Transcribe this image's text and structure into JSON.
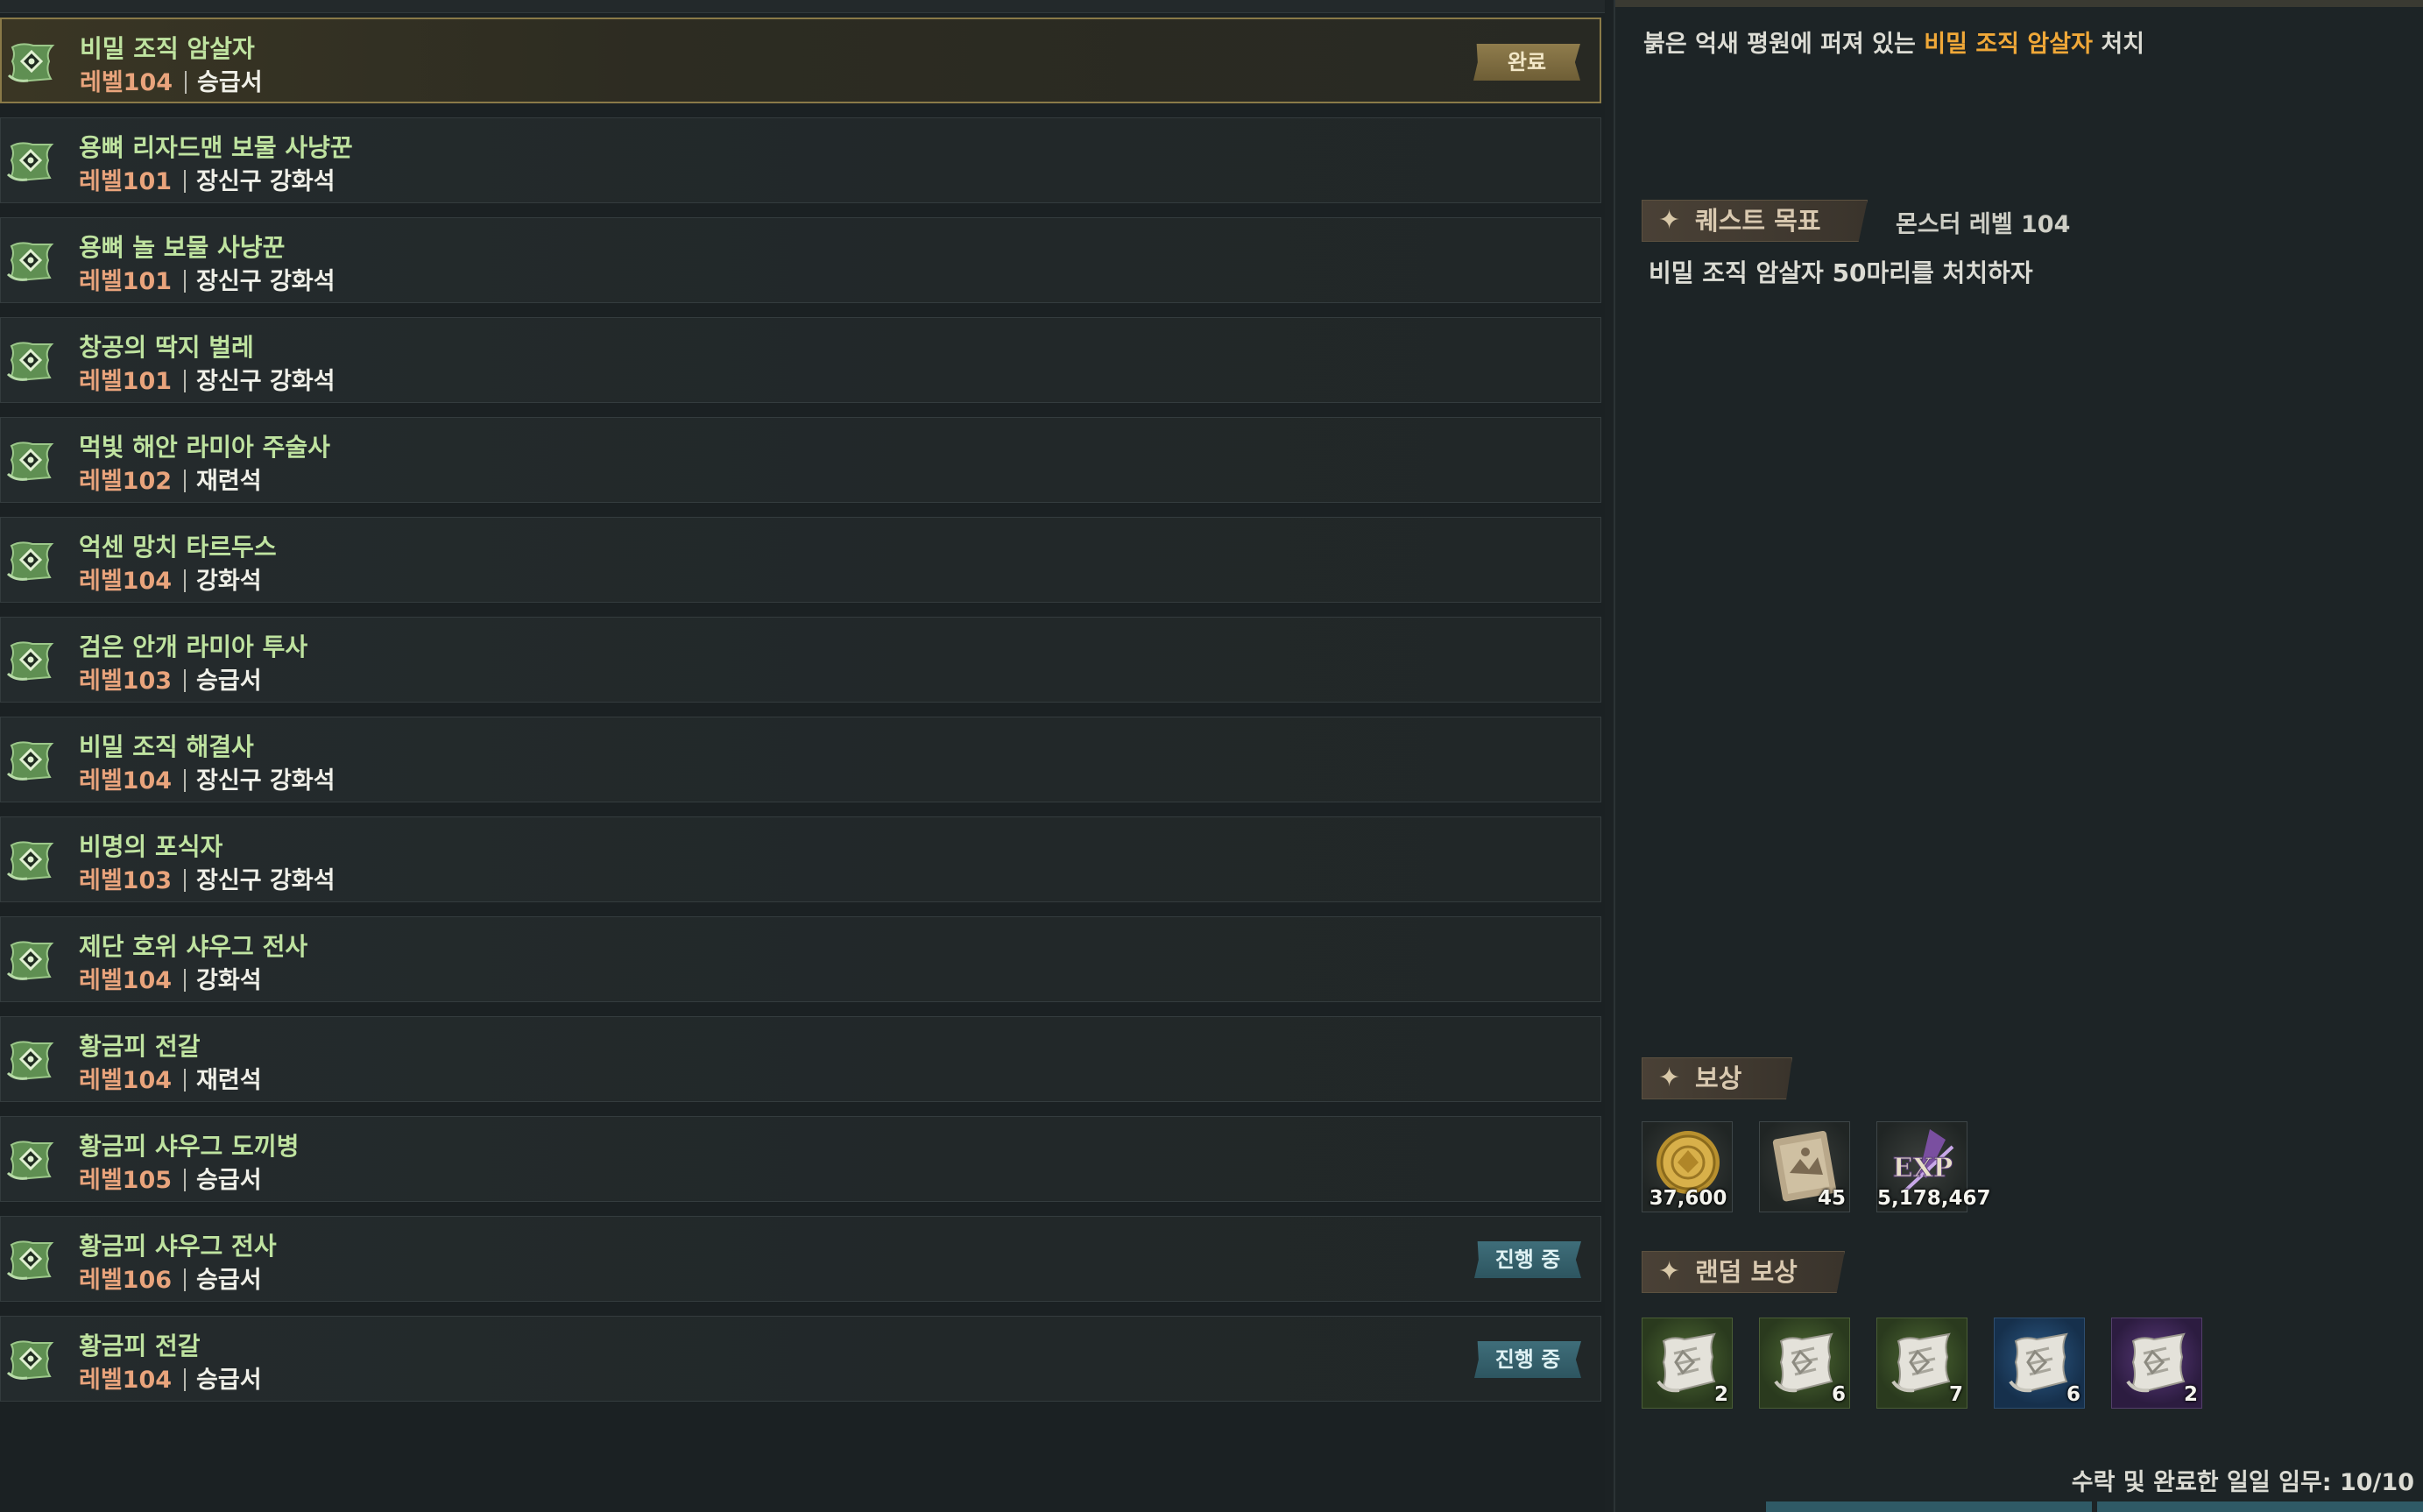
{
  "quests": [
    {
      "name": "비밀 조직 암살자",
      "level": "레벨104",
      "reward": "승급서",
      "status": "완료",
      "selected": true
    },
    {
      "name": "용뼈 리자드맨 보물 사냥꾼",
      "level": "레벨101",
      "reward": "장신구 강화석",
      "status": ""
    },
    {
      "name": "용뼈 놀 보물 사냥꾼",
      "level": "레벨101",
      "reward": "장신구 강화석",
      "status": ""
    },
    {
      "name": "창공의 딱지 벌레",
      "level": "레벨101",
      "reward": "장신구 강화석",
      "status": ""
    },
    {
      "name": "먹빛 해안 라미아 주술사",
      "level": "레벨102",
      "reward": "재련석",
      "status": ""
    },
    {
      "name": "억센 망치 타르두스",
      "level": "레벨104",
      "reward": "강화석",
      "status": ""
    },
    {
      "name": "검은 안개 라미아 투사",
      "level": "레벨103",
      "reward": "승급서",
      "status": ""
    },
    {
      "name": "비밀 조직 해결사",
      "level": "레벨104",
      "reward": "장신구 강화석",
      "status": ""
    },
    {
      "name": "비명의 포식자",
      "level": "레벨103",
      "reward": "장신구 강화석",
      "status": ""
    },
    {
      "name": "제단 호위 샤우그 전사",
      "level": "레벨104",
      "reward": "강화석",
      "status": ""
    },
    {
      "name": "황금피 전갈",
      "level": "레벨104",
      "reward": "재련석",
      "status": ""
    },
    {
      "name": "황금피 샤우그 도끼병",
      "level": "레벨105",
      "reward": "승급서",
      "status": ""
    },
    {
      "name": "황금피 샤우그 전사",
      "level": "레벨106",
      "reward": "승급서",
      "status": "진행 중"
    },
    {
      "name": "황금피 전갈",
      "level": "레벨104",
      "reward": "승급서",
      "status": "진행 중"
    }
  ],
  "detail": {
    "description_prefix": "붉은 억새 평원에 퍼져 있는 ",
    "description_highlight": "비밀 조직 암살자",
    "description_suffix": " 처치",
    "objective_label": "퀘스트 목표",
    "objective_monster_level": "몬스터 레벨 104",
    "objective_text": "비밀 조직 암살자 50마리를 처치하자",
    "reward_label": "보상",
    "rewards": [
      {
        "icon": "gold-coin-icon",
        "count": "37,600"
      },
      {
        "icon": "map-scroll-icon",
        "count": "45"
      },
      {
        "icon": "exp-icon",
        "count": "5,178,467",
        "badge": "EXP"
      }
    ],
    "random_reward_label": "랜덤 보상",
    "random_rewards": [
      {
        "icon": "scroll-icon",
        "grade": "green",
        "count": "2"
      },
      {
        "icon": "scroll-icon",
        "grade": "green",
        "count": "6"
      },
      {
        "icon": "scroll-icon",
        "grade": "green",
        "count": "7"
      },
      {
        "icon": "scroll-icon",
        "grade": "blue",
        "count": "6"
      },
      {
        "icon": "scroll-icon",
        "grade": "purple",
        "count": "2"
      }
    ]
  },
  "footer": {
    "daily_text": "수락 및 완료한 일일 임무: 10/10"
  },
  "colors": {
    "quest_name": "#bfe3a0",
    "quest_level": "#e9a47c",
    "highlight": "#f0a838",
    "done_badge": "#8f7c4c",
    "progress_badge": "#3f6e7a"
  }
}
